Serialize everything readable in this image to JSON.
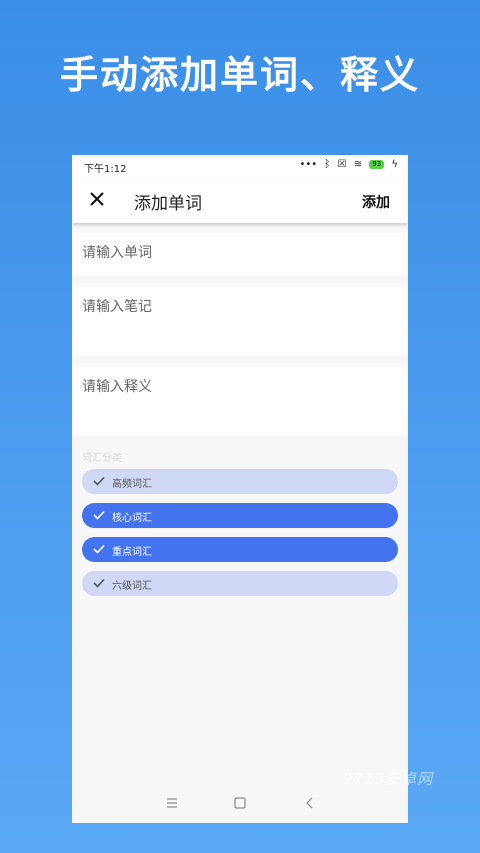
{
  "headline": "手动添加单词、释义",
  "statusbar": {
    "time": "下午1:12",
    "battery": "93"
  },
  "appbar": {
    "title": "添加单词",
    "add_label": "添加"
  },
  "fields": {
    "word_placeholder": "请输入单词",
    "note_placeholder": "请输入笔记",
    "meaning_placeholder": "请输入释义"
  },
  "wordbook_label": "词汇分类",
  "chips": [
    {
      "label": "高频词汇",
      "selected": false
    },
    {
      "label": "核心词汇",
      "selected": true
    },
    {
      "label": "重点词汇",
      "selected": true
    },
    {
      "label": "六级词汇",
      "selected": false
    }
  ],
  "watermark": "9713安卓网",
  "colors": {
    "accent": "#4473ef",
    "chip_off": "#cfd8f5",
    "background": "#3b8ee6"
  }
}
